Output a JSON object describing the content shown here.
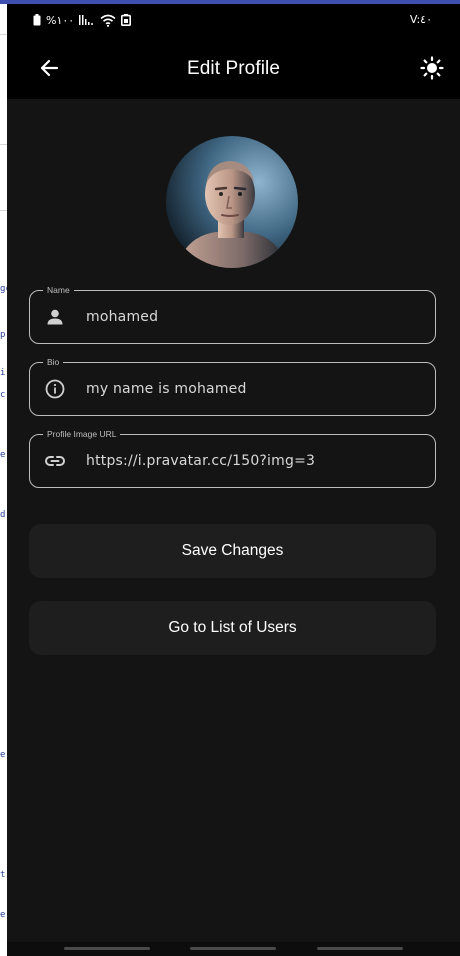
{
  "status_bar": {
    "battery_text": "%١٠٠",
    "signal_text": "l",
    "time": "V:٤٠"
  },
  "app_bar": {
    "title": "Edit Profile",
    "back_icon": "arrow-left-icon",
    "theme_icon": "sun-icon"
  },
  "profile": {
    "avatar": "profile-photo"
  },
  "form": {
    "name": {
      "label": "Name",
      "value": "mohamed",
      "icon": "person-icon"
    },
    "bio": {
      "label": "Bio",
      "value": "my name is mohamed",
      "icon": "info-icon"
    },
    "image_url": {
      "label": "Profile Image URL",
      "value": "https://i.pravatar.cc/150?img=3",
      "icon": "link-icon"
    }
  },
  "actions": {
    "save_label": "Save Changes",
    "list_users_label": "Go to List of Users"
  },
  "background_strip": [
    "gc",
    "p",
    "i",
    "c",
    "e",
    "d",
    "e",
    "t",
    "e"
  ],
  "colors": {
    "background": "#141414",
    "app_bar": "#000000",
    "button": "#1e1e1e",
    "field_border": "#bdbdbd",
    "accent_top": "#3d4fb0"
  }
}
